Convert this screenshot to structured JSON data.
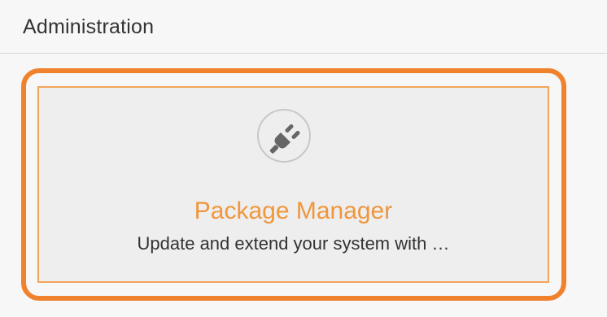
{
  "header": {
    "title": "Administration"
  },
  "tile": {
    "icon": "plug-icon",
    "title": "Package Manager",
    "description": "Update and extend your system with …"
  },
  "colors": {
    "highlight": "#f0822e",
    "tile_title": "#f0963c",
    "icon": "#666666"
  }
}
